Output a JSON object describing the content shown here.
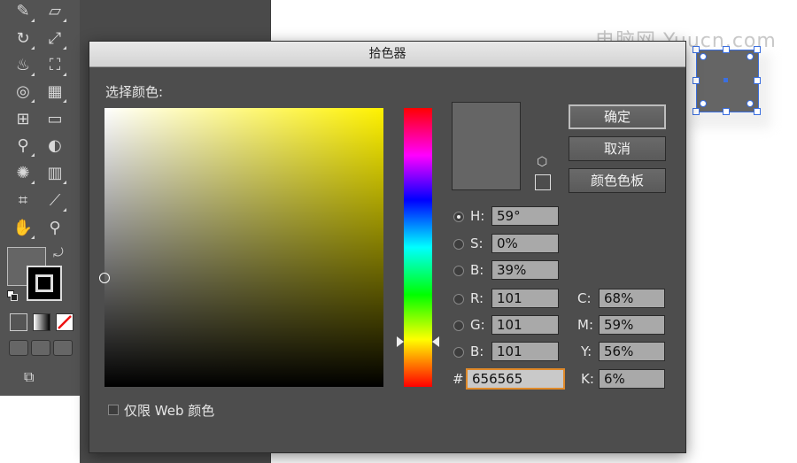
{
  "dialog": {
    "title": "拾色器",
    "select_color_label": "选择颜色:",
    "buttons": {
      "ok": "确定",
      "cancel": "取消",
      "swatches": "颜色色板"
    },
    "hsb": [
      {
        "label": "H:",
        "value": "59°",
        "selected": true
      },
      {
        "label": "S:",
        "value": "0%",
        "selected": false
      },
      {
        "label": "B:",
        "value": "39%",
        "selected": false
      }
    ],
    "rgb": [
      {
        "label": "R:",
        "value": "101"
      },
      {
        "label": "G:",
        "value": "101"
      },
      {
        "label": "B:",
        "value": "101"
      }
    ],
    "cmyk": [
      {
        "label": "C:",
        "value": "68%"
      },
      {
        "label": "M:",
        "value": "59%"
      },
      {
        "label": "Y:",
        "value": "56%"
      },
      {
        "label": "K:",
        "value": "6%"
      }
    ],
    "hex_label": "#",
    "hex_value": "656565",
    "web_only_label": "仅限 Web 颜色",
    "current_color": "#656565",
    "hue_color": "#fff200"
  },
  "toolbar": {
    "fill_color": "#656565",
    "stroke_color": "#000000",
    "icons": [
      "paint-brush-icon",
      "eraser-icon",
      "rotate-icon",
      "scale-icon",
      "warp-icon",
      "free-transform-icon",
      "shape-builder-icon",
      "perspective-grid-icon",
      "mesh-icon",
      "gradient-icon",
      "eyedropper-icon",
      "blend-icon",
      "symbol-sprayer-icon",
      "column-graph-icon",
      "artboard-icon",
      "slice-icon",
      "hand-icon",
      "zoom-icon"
    ]
  },
  "watermark": "电脑网 Yuucn.com",
  "colors": {
    "selection": "#3b6fe0",
    "dialog_bg": "#4d4d4d",
    "hex_focus": "#e08a2a"
  }
}
